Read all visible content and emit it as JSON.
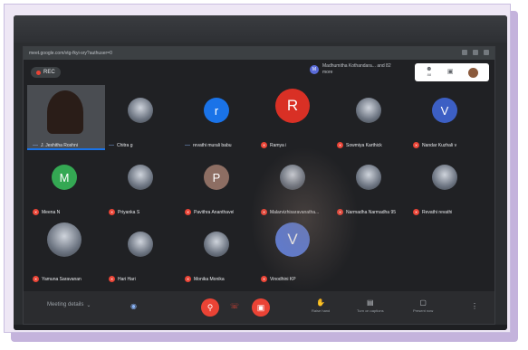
{
  "browser": {
    "url": "meet.google.com/vtg-fkyi-sry?authuser=0"
  },
  "meeting": {
    "rec_label": "REC",
    "presenter_initial": "M",
    "presenter_text": "Madhumitha Kothandara... and 82 more",
    "topright_people_count": "88",
    "details_label": "Meeting details",
    "colors": {
      "accent": "#1a73e8",
      "danger": "#ea4335",
      "surface": "#202124"
    }
  },
  "bottom_actions": {
    "raise_hand": "Raise hand",
    "captions": "Turn on captions",
    "present": "Present now"
  },
  "participants": [
    {
      "name": "J. Jeshitha Roshni",
      "type": "video",
      "avatar": ""
    },
    {
      "name": "Chitra g",
      "type": "photo",
      "avatar": ""
    },
    {
      "name": "revathi murali babu",
      "type": "letter",
      "avatar": "r",
      "color": "#1a73e8"
    },
    {
      "name": "Ramya i",
      "type": "letter",
      "avatar": "R",
      "color": "#d93025",
      "big": true
    },
    {
      "name": "Sowmiya Karthick",
      "type": "photo",
      "avatar": ""
    },
    {
      "name": "Nandar Kuzhali v",
      "type": "letter",
      "avatar": "V",
      "color": "#3c5fc4"
    },
    {
      "name": "Meena N",
      "type": "letter",
      "avatar": "M",
      "color": "#34a853"
    },
    {
      "name": "Priyanka S",
      "type": "photo",
      "avatar": ""
    },
    {
      "name": "Pavithra Ananthavel",
      "type": "letter",
      "avatar": "P",
      "color": "#8d6e63"
    },
    {
      "name": "Malarvizhisaravanatha...",
      "type": "photo",
      "avatar": ""
    },
    {
      "name": "Narmadha Narmadha 95",
      "type": "photo",
      "avatar": ""
    },
    {
      "name": "Revathi revathi",
      "type": "photo",
      "avatar": ""
    },
    {
      "name": "Yamuna Saravanan",
      "type": "photo",
      "avatar": "",
      "big": true
    },
    {
      "name": "Hari Hari",
      "type": "photo",
      "avatar": ""
    },
    {
      "name": "Monika Monika",
      "type": "photo",
      "avatar": ""
    },
    {
      "name": "Vinodhini KP",
      "type": "letter",
      "avatar": "V",
      "color": "#5a7bd8",
      "big": true
    }
  ]
}
